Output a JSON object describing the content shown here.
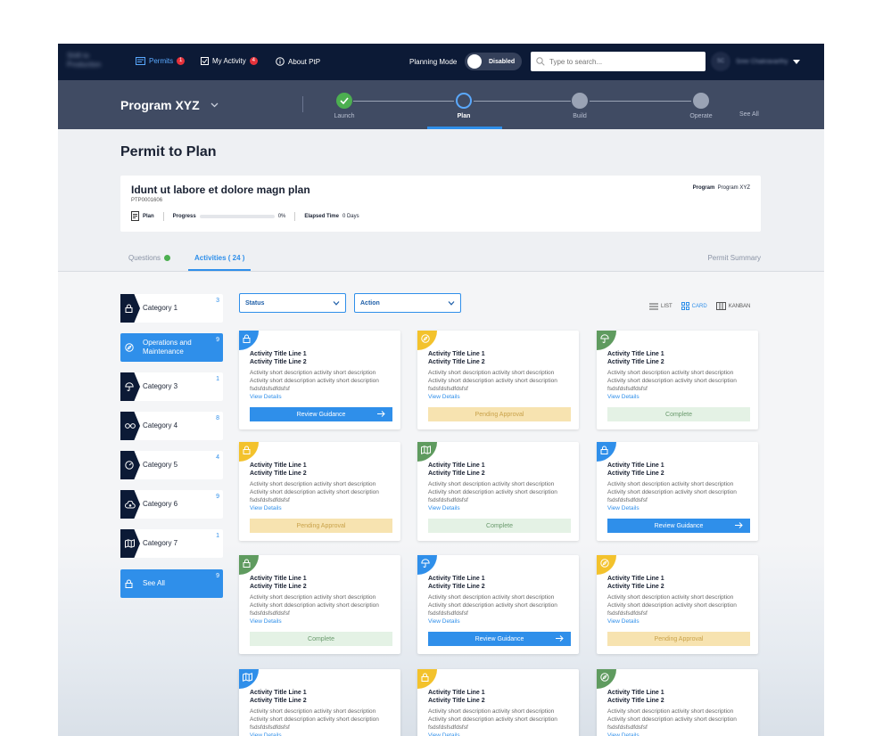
{
  "nav": {
    "logo_line1": "Shift to",
    "logo_line2": "Production",
    "permits_label": "Permits",
    "permits_count": "1",
    "my_activity_label": "My Activity",
    "my_activity_count": "4",
    "about_label": "About PtP",
    "planning_mode_label": "Planning Mode",
    "planning_mode_value": "Disabled",
    "search_placeholder": "Type to search...",
    "user_initials": "SC",
    "user_name": "Sree Chakravarthy"
  },
  "program": {
    "title": "Program XYZ",
    "steps": [
      {
        "label": "Launch",
        "state": "done"
      },
      {
        "label": "Plan",
        "state": "current"
      },
      {
        "label": "Build",
        "state": "todo"
      },
      {
        "label": "Operate",
        "state": "todo"
      }
    ],
    "see_all": "See All"
  },
  "page": {
    "title": "Permit to Plan",
    "plan_title": "Idunt ut labore et dolore magn plan",
    "plan_id": "PTP0001606",
    "program_label": "Program",
    "program_value": "Program XYZ",
    "type_label": "Plan",
    "progress_label": "Progress",
    "progress_value": "0%",
    "progress_fraction": 0,
    "elapsed_label": "Elapsed Time",
    "elapsed_value": "0 Days"
  },
  "tabs": {
    "questions": "Questions",
    "activities": "Activities ( 24 )",
    "summary": "Permit Summary"
  },
  "categories": [
    {
      "label": "Category 1",
      "count": "3",
      "icon": "lock-icon"
    },
    {
      "label": "Operations and Maintenance",
      "count": "9",
      "icon": "compass-icon",
      "active": true
    },
    {
      "label": "Category 3",
      "count": "1",
      "icon": "umbrella-icon"
    },
    {
      "label": "Category 4",
      "count": "8",
      "icon": "glasses-icon"
    },
    {
      "label": "Category 5",
      "count": "4",
      "icon": "gauge-icon"
    },
    {
      "label": "Category 6",
      "count": "9",
      "icon": "cloud-icon"
    },
    {
      "label": "Category 7",
      "count": "1",
      "icon": "map-icon"
    },
    {
      "label": "See All",
      "count": "9",
      "icon": "lock-icon",
      "see_all": true
    }
  ],
  "filters": {
    "status": "Status",
    "action": "Action",
    "list": "LIST",
    "card": "CARD",
    "kanban": "KANBAN"
  },
  "card_text": {
    "title1": "Activity Title Line 1",
    "title2": "Activity Title Line 2",
    "desc1": "Activity short description activity  short description",
    "desc2": "Activity short  ddescription activity short description",
    "desc3": "fsdsfdsfsdfdsfsf",
    "view": "View Details",
    "review": "Review Guidance",
    "pending": "Pending Approval",
    "complete": "Complete"
  },
  "cards": [
    {
      "color": "#2f8fea",
      "icon": "lock-icon",
      "status": "review"
    },
    {
      "color": "#f3c22c",
      "icon": "compass-icon",
      "status": "pending"
    },
    {
      "color": "#5f9b5f",
      "icon": "umbrella-icon",
      "status": "complete"
    },
    {
      "color": "#f3c22c",
      "icon": "lock-icon",
      "status": "pending"
    },
    {
      "color": "#5f9b5f",
      "icon": "map-icon",
      "status": "complete"
    },
    {
      "color": "#2f8fea",
      "icon": "lock-icon",
      "status": "review"
    },
    {
      "color": "#5f9b5f",
      "icon": "lock-icon",
      "status": "complete"
    },
    {
      "color": "#2f8fea",
      "icon": "umbrella-icon",
      "status": "review"
    },
    {
      "color": "#f3c22c",
      "icon": "compass-icon",
      "status": "pending"
    },
    {
      "color": "#2f8fea",
      "icon": "map-icon",
      "status": "none"
    },
    {
      "color": "#f3c22c",
      "icon": "lock-icon",
      "status": "none"
    },
    {
      "color": "#5f9b5f",
      "icon": "compass-icon",
      "status": "none"
    }
  ]
}
